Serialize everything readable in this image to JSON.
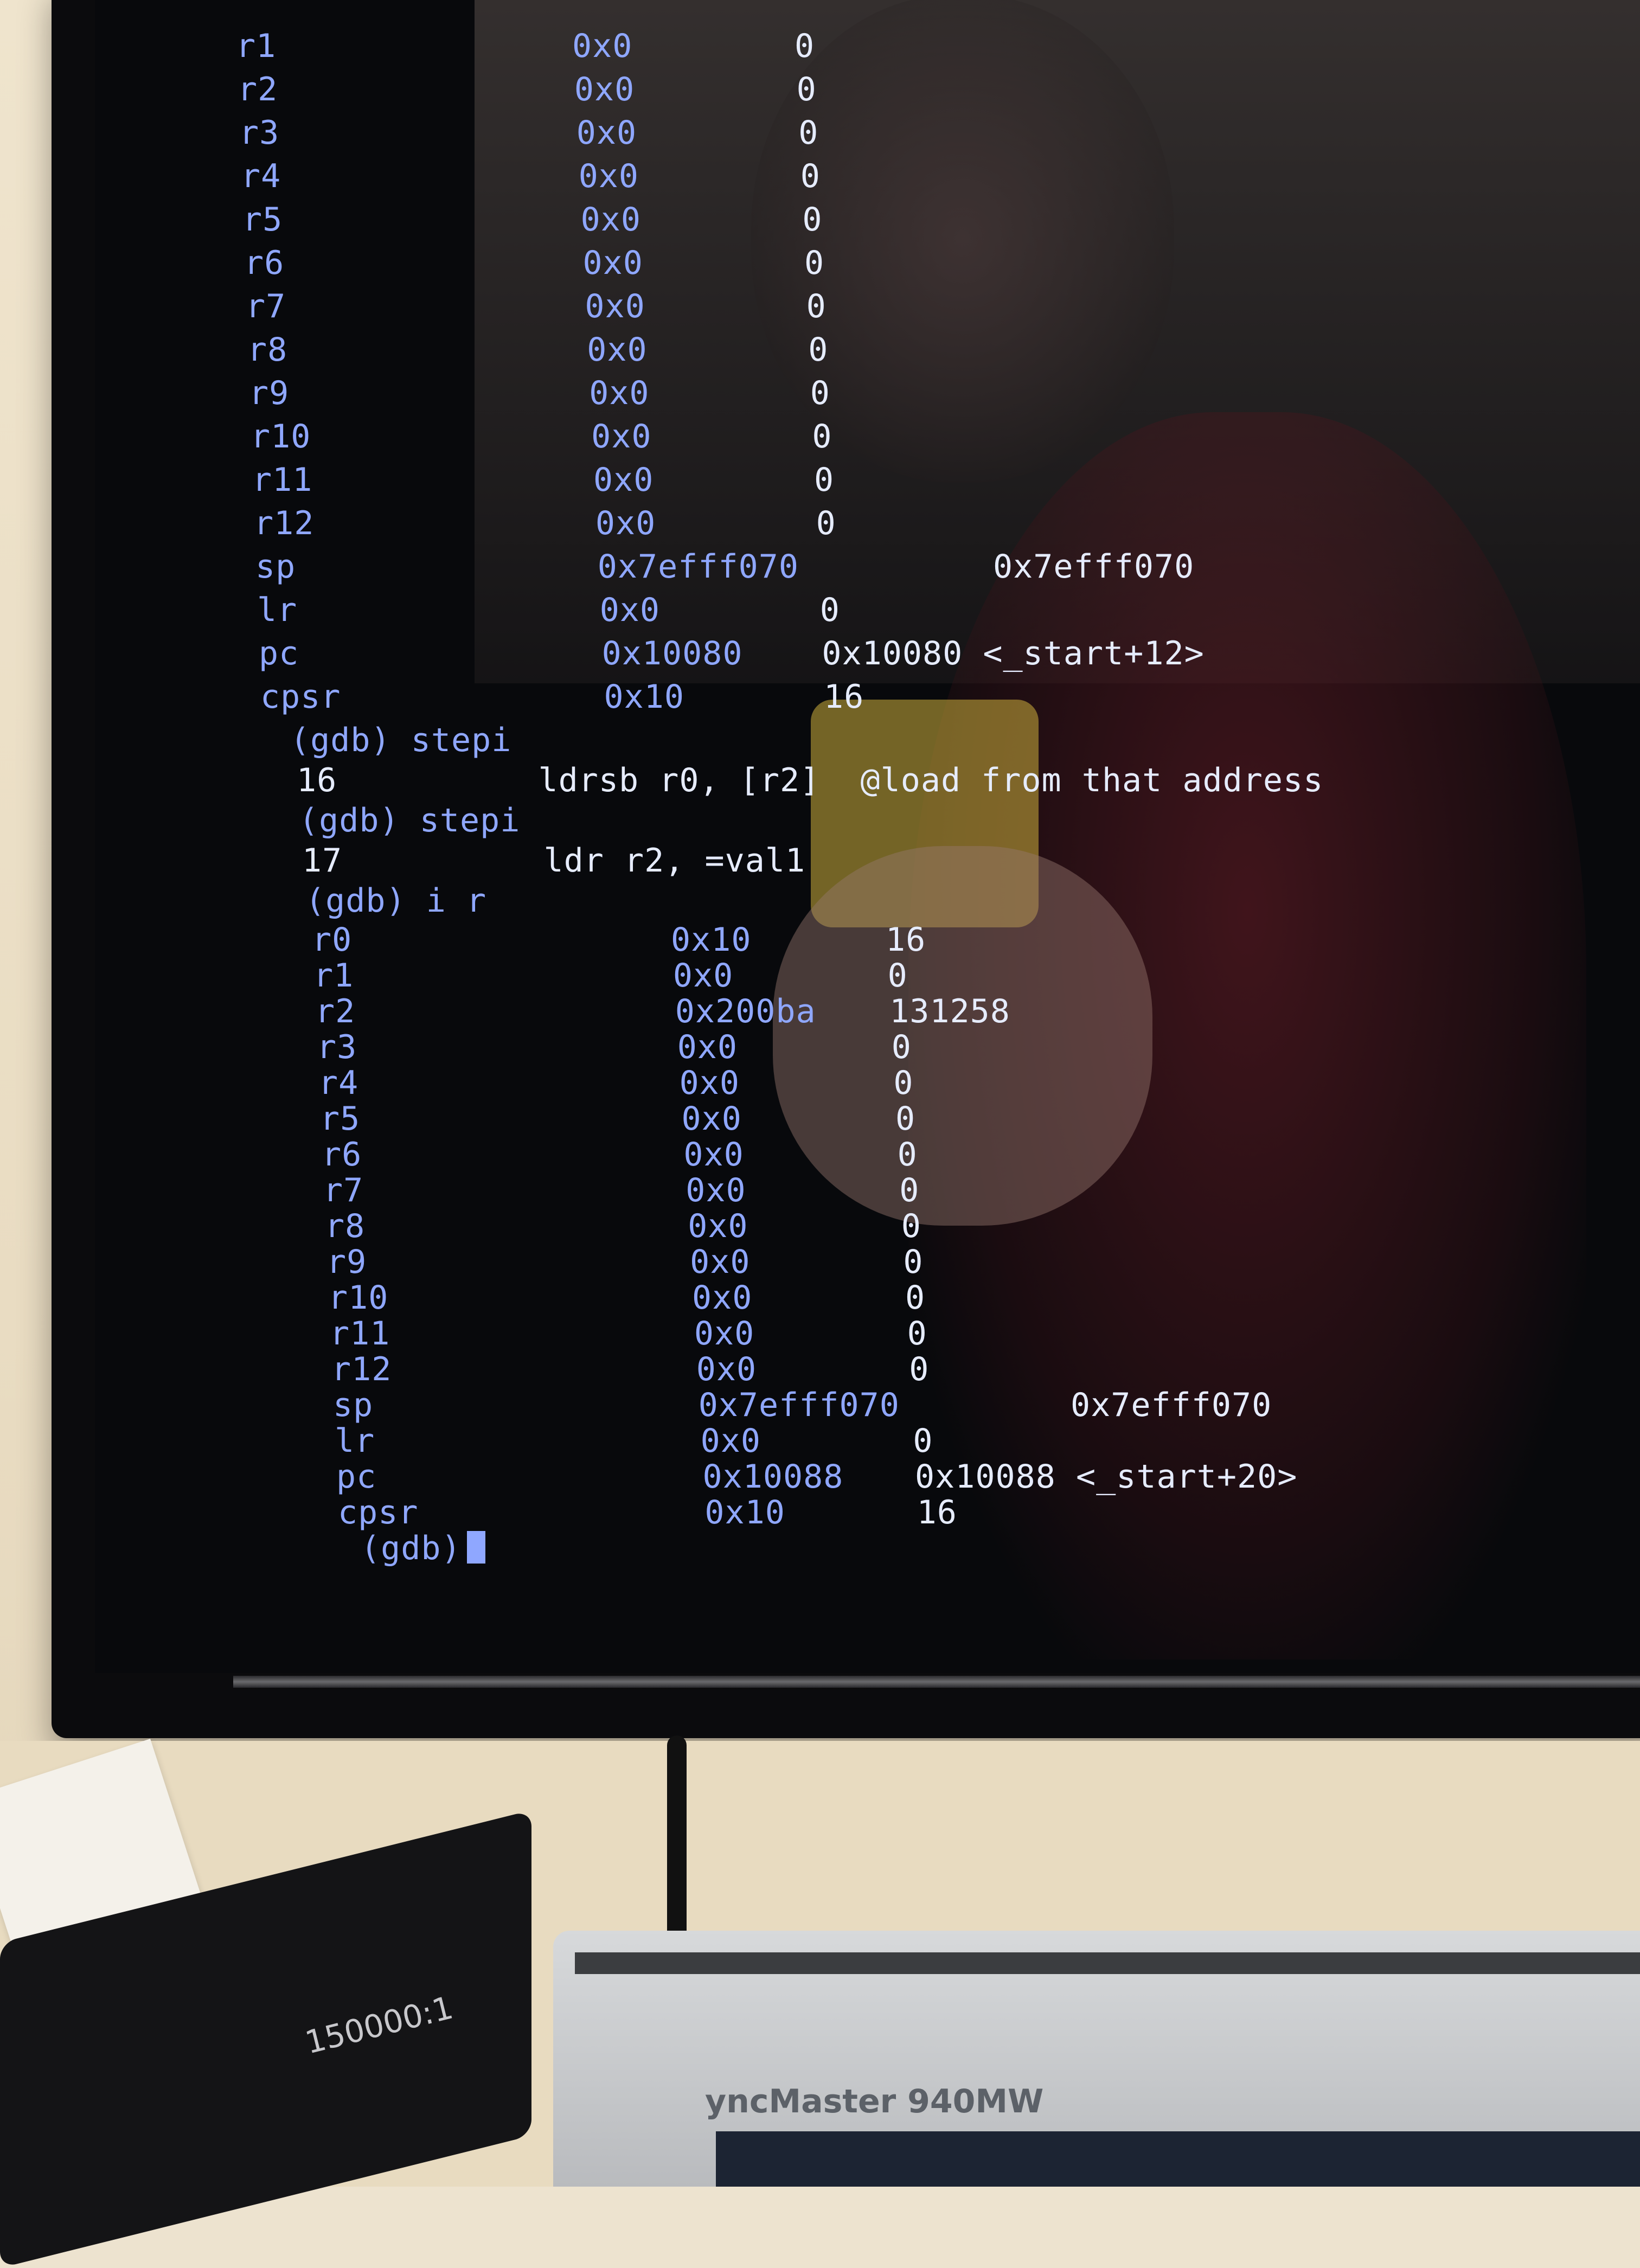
{
  "terminal": {
    "registers_top": [
      {
        "name": "r1",
        "hex": "0x0",
        "dec": "0",
        "extra": ""
      },
      {
        "name": "r2",
        "hex": "0x0",
        "dec": "0",
        "extra": ""
      },
      {
        "name": "r3",
        "hex": "0x0",
        "dec": "0",
        "extra": ""
      },
      {
        "name": "r4",
        "hex": "0x0",
        "dec": "0",
        "extra": ""
      },
      {
        "name": "r5",
        "hex": "0x0",
        "dec": "0",
        "extra": ""
      },
      {
        "name": "r6",
        "hex": "0x0",
        "dec": "0",
        "extra": ""
      },
      {
        "name": "r7",
        "hex": "0x0",
        "dec": "0",
        "extra": ""
      },
      {
        "name": "r8",
        "hex": "0x0",
        "dec": "0",
        "extra": ""
      },
      {
        "name": "r9",
        "hex": "0x0",
        "dec": "0",
        "extra": ""
      },
      {
        "name": "r10",
        "hex": "0x0",
        "dec": "0",
        "extra": ""
      },
      {
        "name": "r11",
        "hex": "0x0",
        "dec": "0",
        "extra": ""
      },
      {
        "name": "r12",
        "hex": "0x0",
        "dec": "0",
        "extra": ""
      },
      {
        "name": "sp",
        "hex": "0x7efff070",
        "dec": "",
        "extra": "0x7efff070"
      },
      {
        "name": "lr",
        "hex": "0x0",
        "dec": "0",
        "extra": ""
      },
      {
        "name": "pc",
        "hex": "0x10080",
        "dec": "0x10080 <_start+12>",
        "extra": ""
      },
      {
        "name": "cpsr",
        "hex": "0x10",
        "dec": "16",
        "extra": ""
      }
    ],
    "cmd1": "(gdb) stepi",
    "src1": "16          ldrsb r0, [r2]  @load from that address",
    "cmd2": "(gdb) stepi",
    "src2": "17          ldr r2, =val1",
    "cmd3": "(gdb) i r",
    "registers_bottom": [
      {
        "name": "r0",
        "hex": "0x10",
        "dec": "16",
        "extra": ""
      },
      {
        "name": "r1",
        "hex": "0x0",
        "dec": "0",
        "extra": ""
      },
      {
        "name": "r2",
        "hex": "0x200ba",
        "dec": "131258",
        "extra": ""
      },
      {
        "name": "r3",
        "hex": "0x0",
        "dec": "0",
        "extra": ""
      },
      {
        "name": "r4",
        "hex": "0x0",
        "dec": "0",
        "extra": ""
      },
      {
        "name": "r5",
        "hex": "0x0",
        "dec": "0",
        "extra": ""
      },
      {
        "name": "r6",
        "hex": "0x0",
        "dec": "0",
        "extra": ""
      },
      {
        "name": "r7",
        "hex": "0x0",
        "dec": "0",
        "extra": ""
      },
      {
        "name": "r8",
        "hex": "0x0",
        "dec": "0",
        "extra": ""
      },
      {
        "name": "r9",
        "hex": "0x0",
        "dec": "0",
        "extra": ""
      },
      {
        "name": "r10",
        "hex": "0x0",
        "dec": "0",
        "extra": ""
      },
      {
        "name": "r11",
        "hex": "0x0",
        "dec": "0",
        "extra": ""
      },
      {
        "name": "r12",
        "hex": "0x0",
        "dec": "0",
        "extra": ""
      },
      {
        "name": "sp",
        "hex": "0x7efff070",
        "dec": "",
        "extra": "0x7efff070"
      },
      {
        "name": "lr",
        "hex": "0x0",
        "dec": "0",
        "extra": ""
      },
      {
        "name": "pc",
        "hex": "0x10088",
        "dec": "0x10088 <_start+20>",
        "extra": ""
      },
      {
        "name": "cpsr",
        "hex": "0x10",
        "dec": "16",
        "extra": ""
      }
    ],
    "prompt": "(gdb)"
  },
  "desk": {
    "small_monitor_label": "150000:1",
    "sync_monitor_label": "yncMaster 940MW"
  }
}
